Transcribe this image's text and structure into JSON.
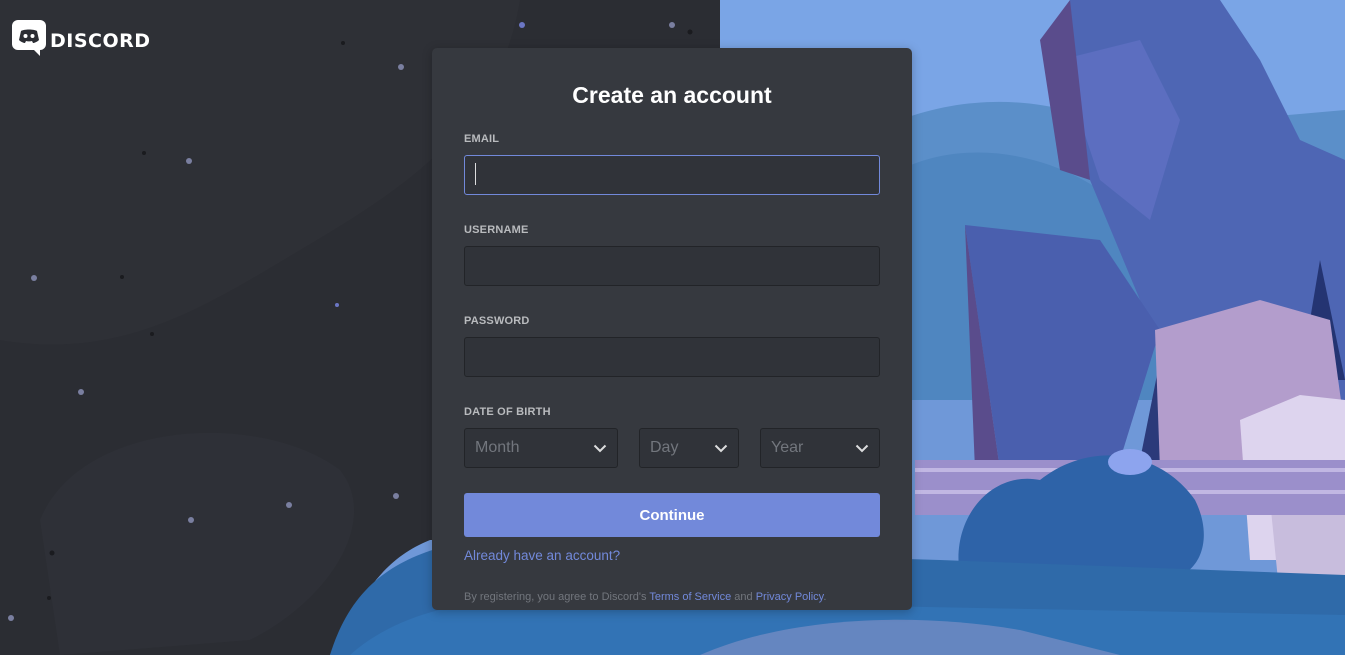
{
  "app": {
    "logo_text": "DISCORD"
  },
  "form": {
    "title": "Create an account",
    "email_label": "EMAIL",
    "email_value": "",
    "username_label": "USERNAME",
    "username_value": "",
    "password_label": "PASSWORD",
    "password_value": "",
    "dob_label": "DATE OF BIRTH",
    "month_placeholder": "Month",
    "day_placeholder": "Day",
    "year_placeholder": "Year",
    "continue_label": "Continue",
    "login_link": "Already have an account?",
    "legal_prefix": "By registering, you agree to Discord's ",
    "terms_link": "Terms of Service",
    "legal_and": " and ",
    "privacy_link": "Privacy Policy",
    "legal_suffix": "."
  },
  "colors": {
    "accent": "#7289da",
    "card_bg": "#36393f",
    "input_bg": "#303339",
    "page_bg": "#2b2d33"
  },
  "icons": {
    "logo": "discord-logo-icon",
    "dropdown": "chevron-down-icon"
  }
}
